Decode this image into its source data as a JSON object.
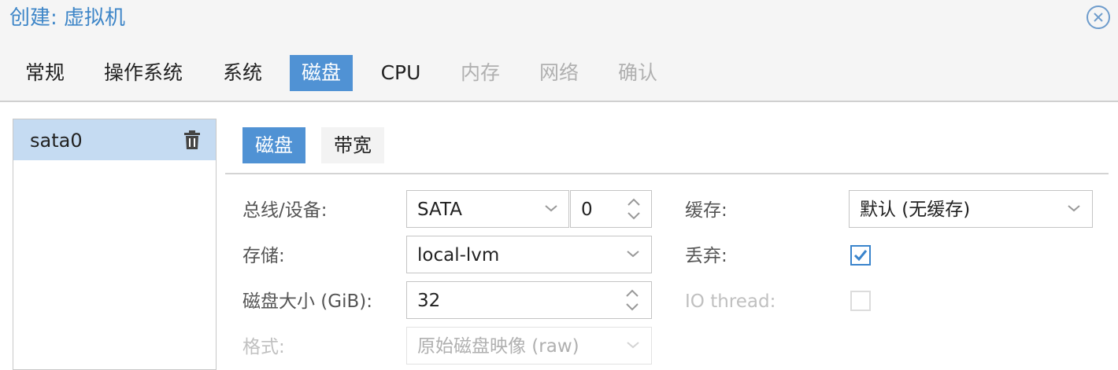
{
  "window": {
    "title": "创建: 虚拟机",
    "close_icon": "close-circle-icon"
  },
  "tabs": [
    {
      "label": "常规",
      "state": "normal"
    },
    {
      "label": "操作系统",
      "state": "normal"
    },
    {
      "label": "系统",
      "state": "normal"
    },
    {
      "label": "磁盘",
      "state": "active"
    },
    {
      "label": "CPU",
      "state": "normal"
    },
    {
      "label": "内存",
      "state": "disabled"
    },
    {
      "label": "网络",
      "state": "disabled"
    },
    {
      "label": "确认",
      "state": "disabled"
    }
  ],
  "disks": [
    {
      "label": "sata0",
      "delete_icon": "trash-icon"
    }
  ],
  "subtabs": [
    {
      "label": "磁盘",
      "active": true
    },
    {
      "label": "带宽",
      "active": false
    }
  ],
  "form": {
    "bus_label": "总线/设备:",
    "bus_value": "SATA",
    "device_value": "0",
    "storage_label": "存储:",
    "storage_value": "local-lvm",
    "size_label": "磁盘大小 (GiB):",
    "size_value": "32",
    "format_label": "格式:",
    "format_value": "原始磁盘映像 (raw)",
    "format_enabled": false,
    "cache_label": "缓存:",
    "cache_value": "默认 (无缓存)",
    "discard_label": "丢弃:",
    "discard_checked": true,
    "iothread_label": "IO thread:",
    "iothread_checked": false,
    "iothread_enabled": false
  },
  "colors": {
    "accent": "#5092d4",
    "title": "#3e86c8",
    "selected_row": "#c5dbf2"
  }
}
